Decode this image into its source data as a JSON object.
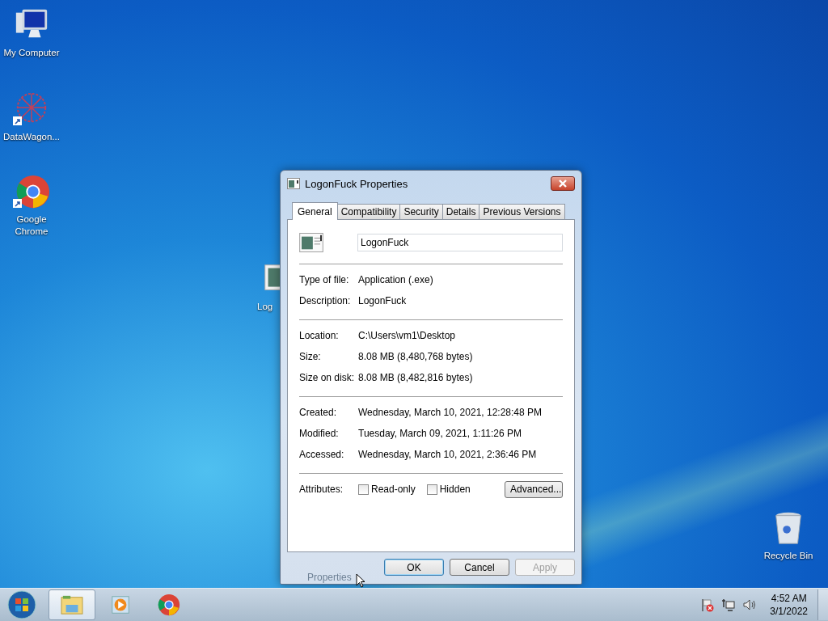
{
  "desktop_icons": [
    {
      "label": "My Computer",
      "kind": "computer"
    },
    {
      "label": "DataWagon...",
      "kind": "network",
      "shortcut": true
    },
    {
      "label": "Google Chrome",
      "kind": "chrome",
      "shortcut": true
    },
    {
      "label": "Log",
      "kind": "app"
    },
    {
      "label": "Recycle Bin",
      "kind": "bin"
    }
  ],
  "dialog": {
    "title": "LogonFuck Properties",
    "tabs": [
      {
        "label": "General",
        "selected": true
      },
      {
        "label": "Compatibility",
        "selected": false
      },
      {
        "label": "Security",
        "selected": false
      },
      {
        "label": "Details",
        "selected": false
      },
      {
        "label": "Previous Versions",
        "selected": false
      }
    ],
    "file_name": "LogonFuck",
    "sections": [
      [
        {
          "label": "Type of file:",
          "value": "Application (.exe)"
        },
        {
          "label": "Description:",
          "value": "LogonFuck"
        }
      ],
      [
        {
          "label": "Location:",
          "value": "C:\\Users\\vm1\\Desktop"
        },
        {
          "label": "Size:",
          "value": "8.08 MB (8,480,768 bytes)"
        },
        {
          "label": "Size on disk:",
          "value": "8.08 MB (8,482,816 bytes)"
        }
      ],
      [
        {
          "label": "Created:",
          "value": "Wednesday, March 10, 2021, 12:28:48 PM"
        },
        {
          "label": "Modified:",
          "value": "Tuesday, March 09, 2021, 1:11:26 PM"
        },
        {
          "label": "Accessed:",
          "value": "Wednesday, March 10, 2021, 2:36:46 PM"
        }
      ]
    ],
    "attributes": {
      "label": "Attributes:",
      "checkboxes": [
        {
          "label": "Read-only",
          "checked": false
        },
        {
          "label": "Hidden",
          "checked": false
        }
      ],
      "advanced_button": "Advanced..."
    },
    "buttons": [
      {
        "label": "OK",
        "default": true,
        "disabled": false
      },
      {
        "label": "Cancel",
        "default": false,
        "disabled": false
      },
      {
        "label": "Apply",
        "default": false,
        "disabled": true
      }
    ]
  },
  "fading_tooltip": "Properties",
  "taskbar": {
    "items": [
      {
        "kind": "explorer",
        "selected": true
      },
      {
        "kind": "media",
        "selected": false
      },
      {
        "kind": "chrome",
        "selected": false
      }
    ],
    "time": "4:52 AM",
    "date": "3/1/2022"
  }
}
